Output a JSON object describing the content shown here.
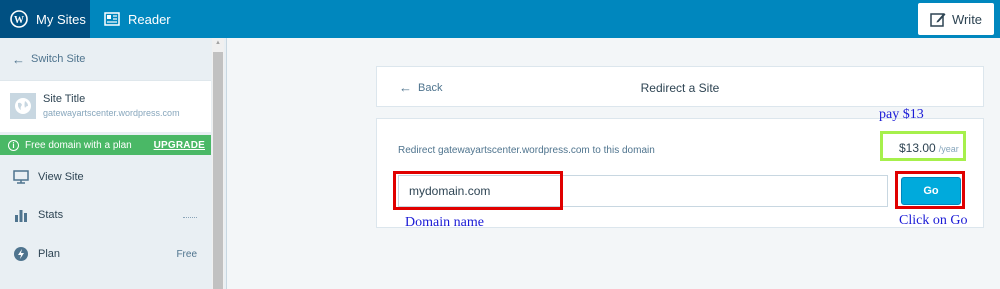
{
  "masterbar": {
    "my_sites": "My Sites",
    "reader": "Reader",
    "write": "Write",
    "bg_color": "#0087be",
    "active_color": "#005082"
  },
  "sidebar": {
    "switch_site": "Switch Site",
    "site": {
      "title": "Site Title",
      "url": "gatewayartscenter.wordpress.com"
    },
    "notice": {
      "text": "Free domain with a plan",
      "action": "UPGRADE",
      "color": "#4ab866"
    },
    "items": [
      {
        "label": "View Site",
        "icon": "monitor-icon",
        "right": ""
      },
      {
        "label": "Stats",
        "icon": "bar-chart-icon",
        "right": ""
      },
      {
        "label": "Plan",
        "icon": "plan-icon",
        "right": "Free"
      }
    ]
  },
  "header_card": {
    "back": "Back",
    "title": "Redirect a Site"
  },
  "redirect_card": {
    "label": "Redirect gatewayartscenter.wordpress.com to this domain",
    "price": "$13.00",
    "price_period": "/year",
    "input_value": "mydomain.com",
    "button": "Go",
    "button_color": "#00aadc"
  },
  "annotations": {
    "pay": "pay $13",
    "domain_name": "Domain name",
    "click_go": "Click on Go",
    "red": "#e00000",
    "green": "#a6f04c",
    "text_color": "#1a1ad6"
  }
}
